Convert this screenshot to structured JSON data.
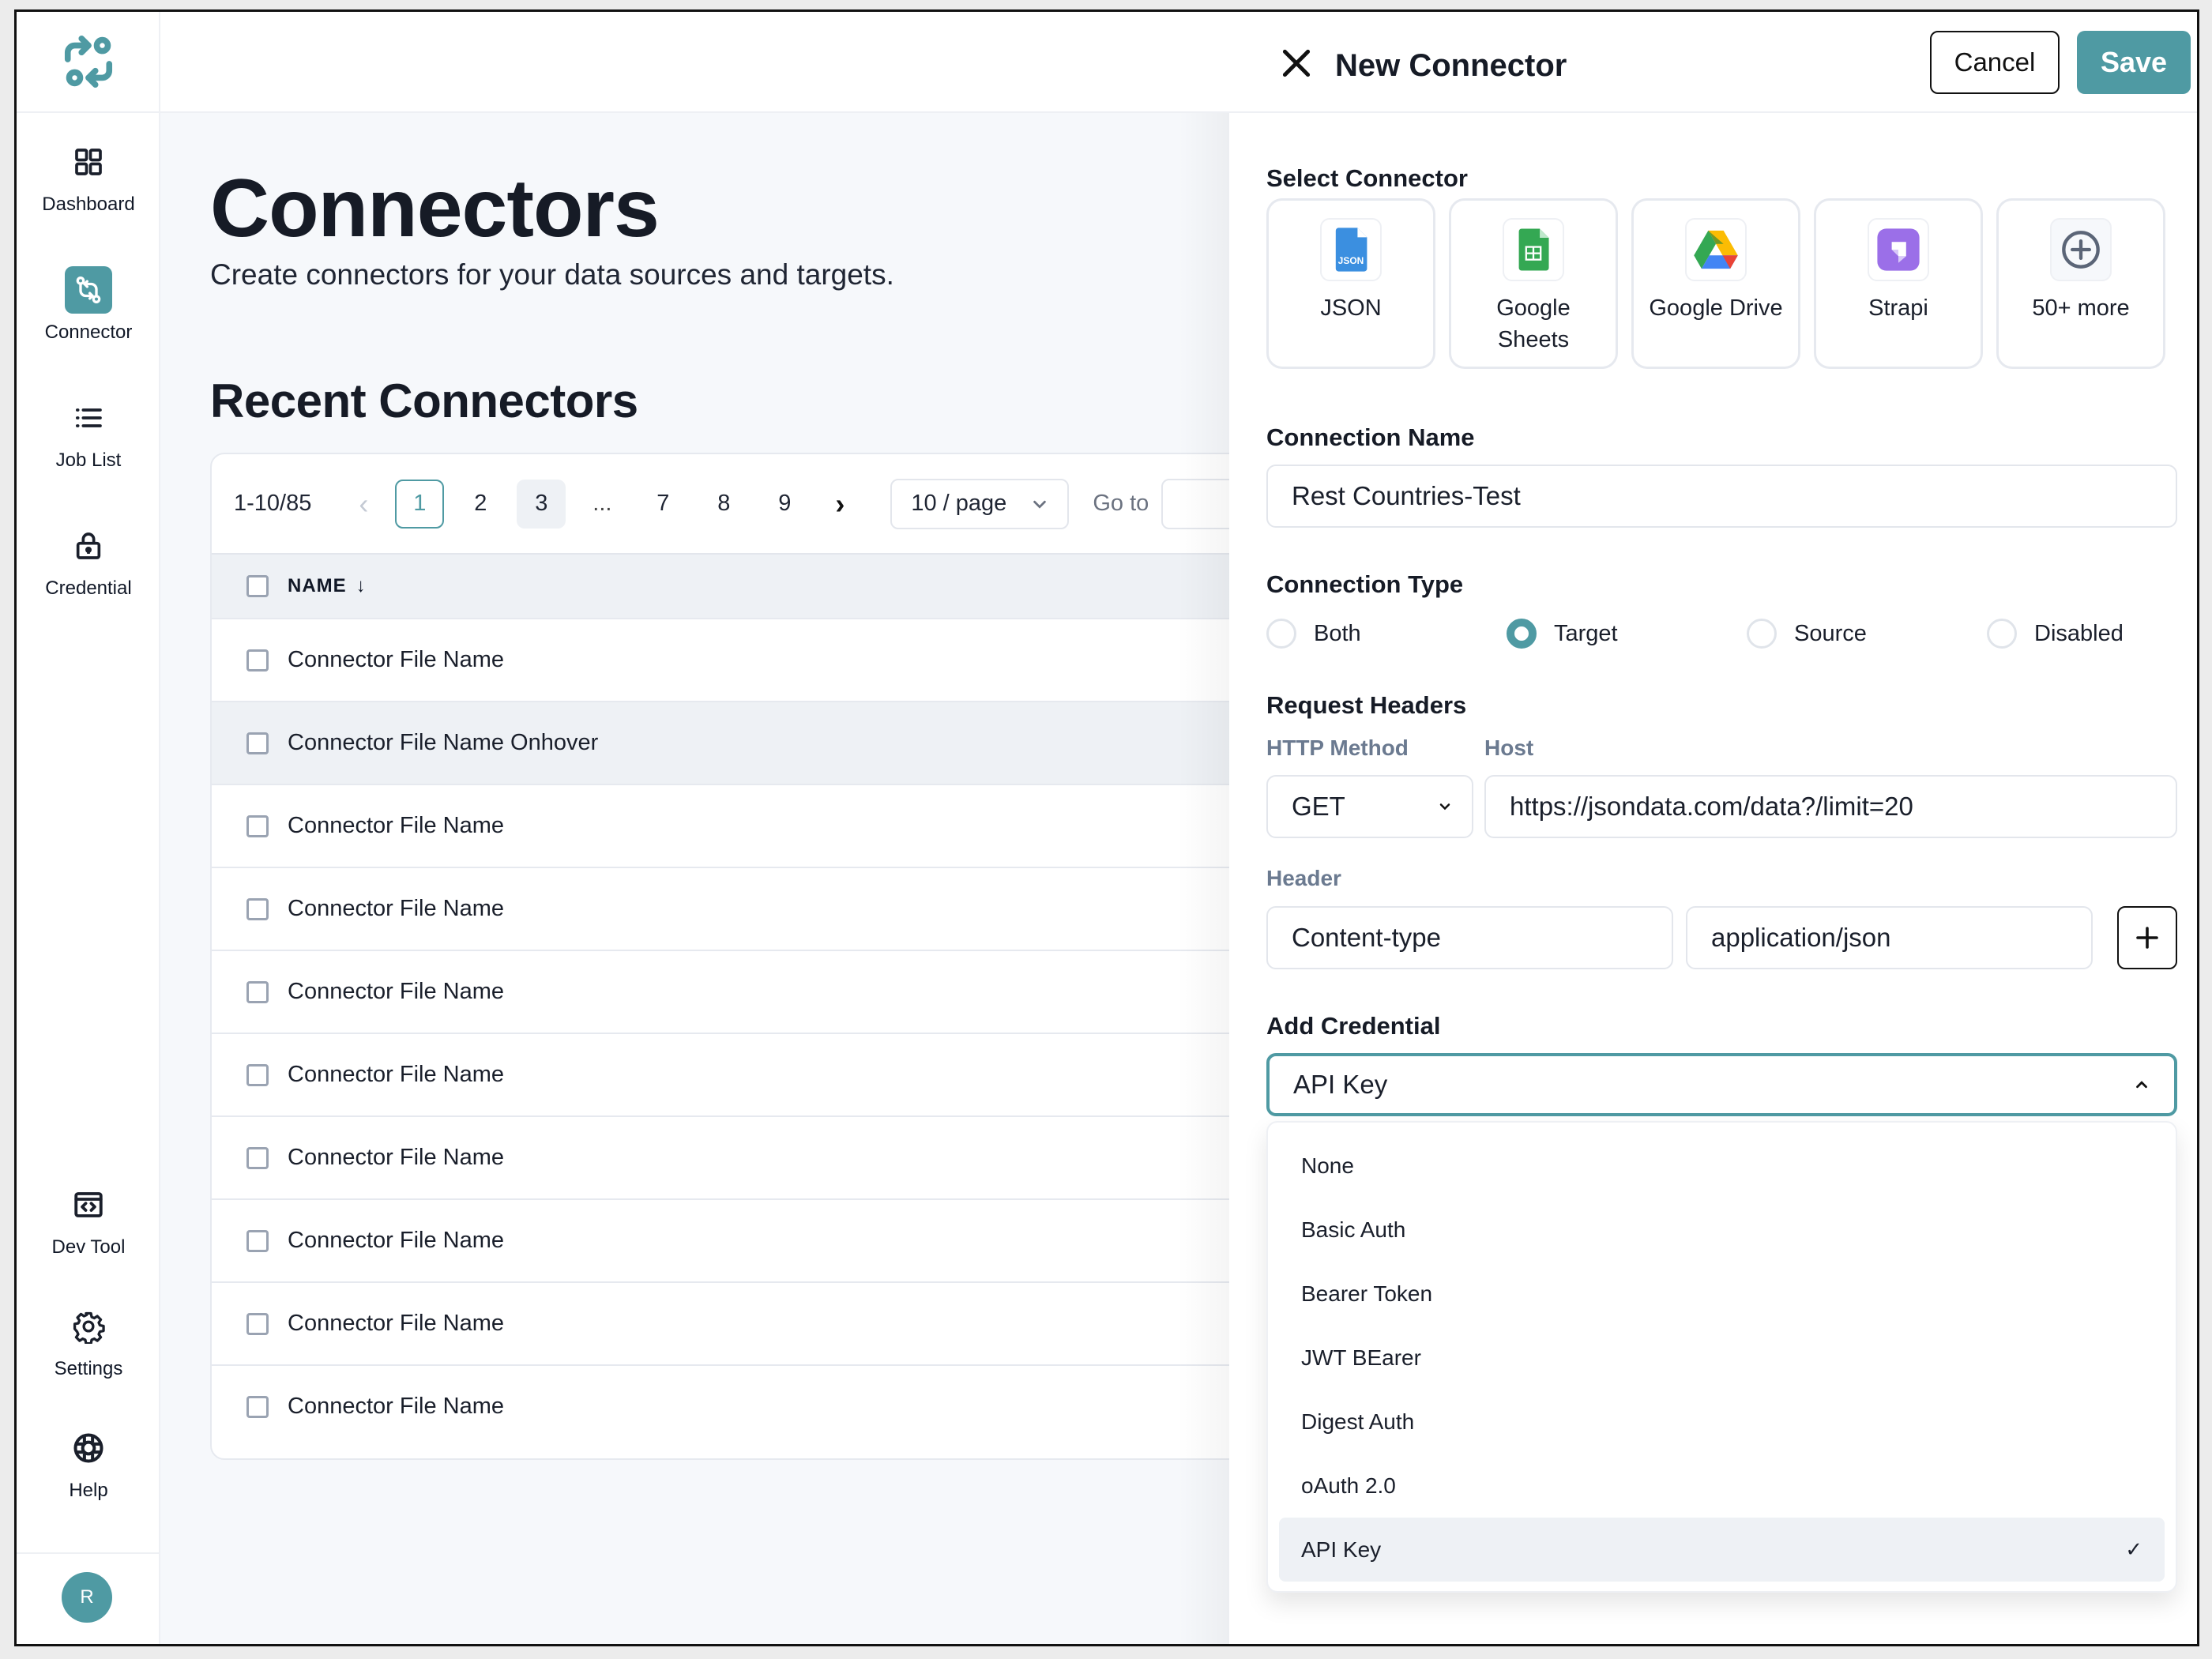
{
  "sidebar": {
    "items": [
      {
        "label": "Dashboard",
        "icon": "grid-icon"
      },
      {
        "label": "Connector",
        "icon": "git-compare-icon",
        "active": true
      },
      {
        "label": "Job List",
        "icon": "list-icon"
      },
      {
        "label": "Credential",
        "icon": "lock-icon"
      },
      {
        "label": "Dev Tool",
        "icon": "code-window-icon"
      },
      {
        "label": "Settings",
        "icon": "gear-icon"
      },
      {
        "label": "Help",
        "icon": "lifebuoy-icon"
      }
    ],
    "avatar_initial": "R"
  },
  "main": {
    "title": "Connectors",
    "subtitle": "Create connectors for your data sources and targets.",
    "section_title": "Recent Connectors",
    "pagination": {
      "range": "1-10/85",
      "pages": [
        "1",
        "2",
        "3",
        "...",
        "7",
        "8",
        "9"
      ],
      "current_page": "1",
      "per_page": "10 / page",
      "goto_label": "Go to",
      "goto_value": ""
    },
    "table": {
      "column_header": "NAME",
      "sort_indicator": "↓",
      "rows": [
        "Connector File Name",
        "Connector File Name Onhover",
        "Connector File Name",
        "Connector File Name",
        "Connector File Name",
        "Connector File Name",
        "Connector File Name",
        "Connector File Name",
        "Connector File Name",
        "Connector File Name"
      ],
      "hover_row_index": 1
    }
  },
  "drawer": {
    "title": "New Connector",
    "cancel_label": "Cancel",
    "save_label": "Save",
    "select_connector_label": "Select Connector",
    "connectors": [
      {
        "label": "JSON",
        "icon": "json-file-icon"
      },
      {
        "label": "Google Sheets",
        "icon": "google-sheets-icon"
      },
      {
        "label": "Google Drive",
        "icon": "google-drive-icon"
      },
      {
        "label": "Strapi",
        "icon": "strapi-icon"
      },
      {
        "label": "50+ more",
        "icon": "plus-circle-icon"
      }
    ],
    "connection_name_label": "Connection Name",
    "connection_name_value": "Rest Countries-Test",
    "connection_type_label": "Connection Type",
    "connection_types": [
      "Both",
      "Target",
      "Source",
      "Disabled"
    ],
    "connection_type_selected": "Target",
    "request_headers_label": "Request Headers",
    "http_method_label": "HTTP Method",
    "http_method_value": "GET",
    "host_label": "Host",
    "host_value": "https://jsondata.com/data?/limit=20",
    "header_label": "Header",
    "header_key": "Content-type",
    "header_value": "application/json",
    "add_credential_label": "Add Credential",
    "credential_selected": "API Key",
    "credential_options": [
      "None",
      "Basic Auth",
      "Bearer Token",
      "JWT BEarer",
      "Digest Auth",
      "oAuth 2.0",
      "API Key"
    ]
  },
  "colors": {
    "accent": "#4f9aa3",
    "hover_bg": "#eef1f5",
    "page_bg": "#f6f8fb"
  }
}
